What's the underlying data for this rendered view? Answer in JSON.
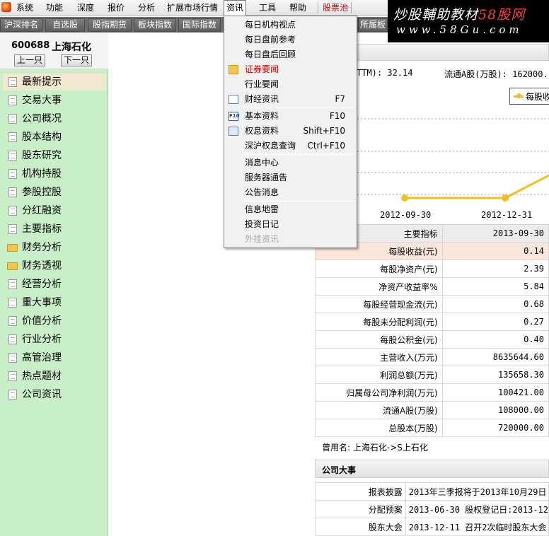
{
  "menubar": {
    "items": [
      "系统",
      "功能",
      "深度",
      "报价",
      "分析",
      "扩展市场行情",
      "资讯",
      "工具",
      "帮助",
      "股票池"
    ]
  },
  "brand": {
    "title": "炒股輔助教材",
    "site": "58股网",
    "url": "www.58Gu.com"
  },
  "toolbar2": {
    "buttons": [
      "沪深排名",
      "自选股",
      "股指期货",
      "板块指数",
      "国际指数",
      "所属板"
    ]
  },
  "stock": {
    "code": "600688",
    "name": "上海石化",
    "prev_label": "上一只",
    "next_label": "下一只"
  },
  "sidebar": {
    "items": [
      {
        "label": "最新提示",
        "icon": "doc-icon"
      },
      {
        "label": "交易大事",
        "icon": "doc-icon"
      },
      {
        "label": "公司概况",
        "icon": "doc-icon"
      },
      {
        "label": "股本结构",
        "icon": "doc-icon"
      },
      {
        "label": "股东研究",
        "icon": "doc-icon"
      },
      {
        "label": "机构持股",
        "icon": "doc-icon"
      },
      {
        "label": "参股控股",
        "icon": "doc-icon"
      },
      {
        "label": "分红融资",
        "icon": "doc-icon"
      },
      {
        "label": "主要指标",
        "icon": "doc-icon"
      },
      {
        "label": "财务分析",
        "icon": "folder-icon"
      },
      {
        "label": "财务透视",
        "icon": "folder-icon"
      },
      {
        "label": "经营分析",
        "icon": "doc-icon"
      },
      {
        "label": "重大事项",
        "icon": "doc-icon"
      },
      {
        "label": "价值分析",
        "icon": "doc-icon"
      },
      {
        "label": "行业分析",
        "icon": "doc-icon"
      },
      {
        "label": "高管治理",
        "icon": "doc-icon"
      },
      {
        "label": "热点题材",
        "icon": "doc-icon"
      },
      {
        "label": "公司资讯",
        "icon": "doc-icon"
      }
    ]
  },
  "dropdown": {
    "items": [
      {
        "label": "每日机构视点",
        "shortcut": "",
        "icon": ""
      },
      {
        "label": "每日盘前参考",
        "shortcut": "",
        "icon": ""
      },
      {
        "label": "每日盘后回顾",
        "shortcut": "",
        "icon": ""
      },
      {
        "label": "证券要闻",
        "shortcut": "",
        "icon": "folder-icon"
      },
      {
        "label": "行业要闻",
        "shortcut": "",
        "icon": ""
      },
      {
        "label": "财经资讯",
        "shortcut": "F7",
        "icon": "sheet-icon"
      },
      {
        "label": "基本资料",
        "shortcut": "F10",
        "icon": "f10-icon"
      },
      {
        "label": "权息资料",
        "shortcut": "Shift+F10",
        "icon": "document-icon"
      },
      {
        "label": "深沪权息查询",
        "shortcut": "Ctrl+F10",
        "icon": ""
      },
      {
        "label": "消息中心",
        "shortcut": "",
        "icon": ""
      },
      {
        "label": "服务器通告",
        "shortcut": "",
        "icon": ""
      },
      {
        "label": "公告消息",
        "shortcut": "",
        "icon": ""
      },
      {
        "label": "信息地雷",
        "shortcut": "",
        "icon": ""
      },
      {
        "label": "投资日记",
        "shortcut": "",
        "icon": ""
      },
      {
        "label": "外挂资讯",
        "shortcut": "",
        "icon": ""
      }
    ]
  },
  "summary": {
    "pe_text": "TTM): 32.14",
    "float_text": "流通A股(万股): 162000."
  },
  "chart_data": {
    "type": "line",
    "x": [
      "2012-09-30",
      "2012-12-31"
    ],
    "series": [
      {
        "name": "每股收",
        "values": [
          null,
          null
        ]
      }
    ],
    "grid": true,
    "legend": "top-right",
    "color": "#f2c01e"
  },
  "indicators": {
    "header_label": "主要指标",
    "header_date": "2013-09-30",
    "rows": [
      {
        "label": "每股收益(元)",
        "value": "0.14"
      },
      {
        "label": "每股净资产(元)",
        "value": "2.39"
      },
      {
        "label": "净资产收益率%",
        "value": "5.84"
      },
      {
        "label": "每股经营现金流(元)",
        "value": "0.68"
      },
      {
        "label": "每股未分配利润(元)",
        "value": "0.27"
      },
      {
        "label": "每股公积金(元)",
        "value": "0.40"
      },
      {
        "label": "主营收入(万元)",
        "value": "8635644.60"
      },
      {
        "label": "利润总额(万元)",
        "value": "135658.30"
      },
      {
        "label": "归属母公司净利润(万元)",
        "value": "100421.00"
      },
      {
        "label": "流通A股(万股)",
        "value": "108000.00"
      },
      {
        "label": "总股本(万股)",
        "value": "720000.00"
      }
    ]
  },
  "former_name": "曾用名: 上海石化->S上石化",
  "events": {
    "title": "公司大事",
    "rows": [
      {
        "label": "报表披露",
        "text": "2013年三季报将于2013年10月29日"
      },
      {
        "label": "分配预案",
        "text": "2013-06-30 股权登记日:2013-12"
      },
      {
        "label": "股东大会",
        "text": "2013-12-11 召开2次临时股东大会"
      }
    ]
  },
  "colors": {
    "sidebar_bg": "#c8efc8",
    "accent_red": "#d00000",
    "chart_line": "#f2c01e",
    "highlight_row": "#fbe6dc"
  }
}
